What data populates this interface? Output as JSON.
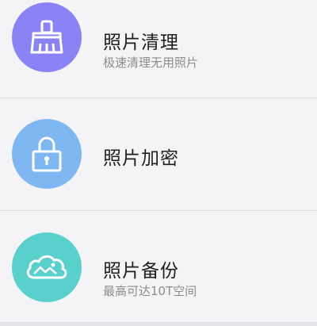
{
  "items": [
    {
      "title": "照片清理",
      "subtitle": "极速清理无用照片",
      "icon": "broom-icon",
      "color": "#8b83f5"
    },
    {
      "title": "照片加密",
      "subtitle": "",
      "icon": "lock-icon",
      "color": "#7fb7f3"
    },
    {
      "title": "照片备份",
      "subtitle": "最高可达10T空间",
      "icon": "cloud-icon",
      "color": "#58d1cd"
    }
  ]
}
